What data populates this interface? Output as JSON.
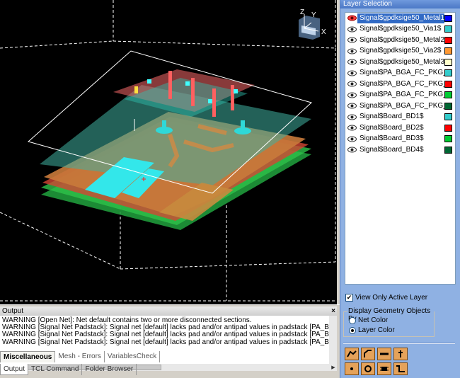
{
  "viewport": {
    "axis_labels": {
      "z": "Z",
      "y": "Y",
      "x": "X"
    }
  },
  "layer_panel": {
    "title": "Layer Selection",
    "layers": [
      {
        "label": "Signal$gpdksige50_Metal1$",
        "color": "#0000ff",
        "selected": true,
        "visible": false
      },
      {
        "label": "Signal$gpdksige50_Via1$",
        "color": "#33cccc",
        "selected": false,
        "visible": true
      },
      {
        "label": "Signal$gpdksige50_Metal2$",
        "color": "#ff0000",
        "selected": false,
        "visible": true
      },
      {
        "label": "Signal$gpdksige50_Via2$",
        "color": "#ff9933",
        "selected": false,
        "visible": true
      },
      {
        "label": "Signal$gpdksige50_Metal3$",
        "color": "#ffffcc",
        "selected": false,
        "visible": true
      },
      {
        "label": "Signal$PA_BGA_FC_PKG_TO",
        "color": "#33cccc",
        "selected": false,
        "visible": true
      },
      {
        "label": "Signal$PA_BGA_FC_PKG_TO",
        "color": "#ff0000",
        "selected": false,
        "visible": true
      },
      {
        "label": "Signal$PA_BGA_FC_PKG_TO",
        "color": "#00cc33",
        "selected": false,
        "visible": true
      },
      {
        "label": "Signal$PA_BGA_FC_PKG_TO",
        "color": "#006633",
        "selected": false,
        "visible": true
      },
      {
        "label": "Signal$Board_BD1$",
        "color": "#33cccc",
        "selected": false,
        "visible": true
      },
      {
        "label": "Signal$Board_BD2$",
        "color": "#ff0000",
        "selected": false,
        "visible": true
      },
      {
        "label": "Signal$Board_BD3$",
        "color": "#00cc33",
        "selected": false,
        "visible": true
      },
      {
        "label": "Signal$Board_BD4$",
        "color": "#006633",
        "selected": false,
        "visible": true
      }
    ],
    "view_only_active_label": "View Only Active Layer",
    "view_only_active_checked": true,
    "display_group_title": "Display Geometry Objects By",
    "options": [
      {
        "label": "Net Color",
        "checked": false
      },
      {
        "label": "Layer Color",
        "checked": true
      }
    ],
    "tools": [
      "trace-tool-icon",
      "bend-tool-icon",
      "line-tool-icon",
      "pin-tool-icon",
      "point-tool-icon",
      "circle-tool-icon",
      "chip-tool-icon",
      "step-tool-icon"
    ]
  },
  "output": {
    "title": "Output",
    "lines": [
      "WARNING [Open Net]: Net default contains two or more disconnected sections.",
      "WARNING [Signal Net Padstack]: Signal net [default] lacks pad and/or antipad values in padstack [PA_BGA_FC_PKG_",
      "WARNING [Signal Net Padstack]: Signal net [default] lacks pad and/or antipad values in padstack [PA_BGA_FC_PKG_",
      "WARNING [Signal Net Padstack]: Signal net [default] lacks pad and/or antipad values in padstack [PA_BGA_FC_PKG_"
    ],
    "tabs_top": [
      "Miscellaneous",
      "Mesh - Errors",
      "VariablesCheck"
    ],
    "tabs_bottom": [
      "Output",
      "TCL Command",
      "Folder Browser"
    ]
  }
}
